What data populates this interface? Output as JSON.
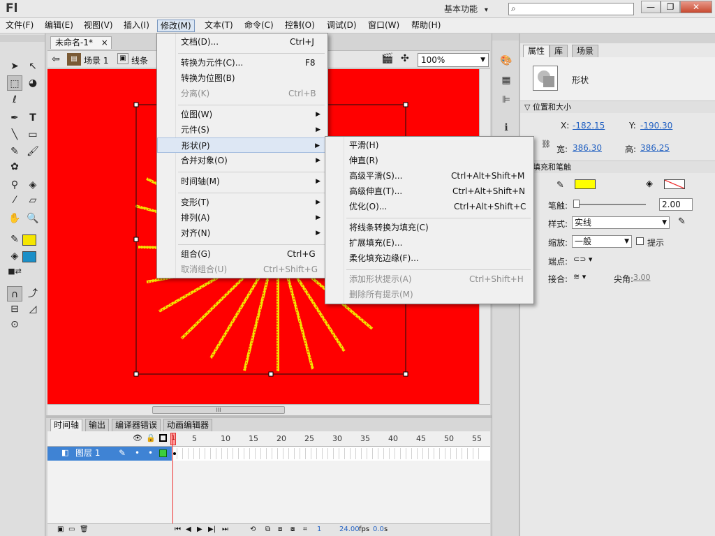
{
  "titlebar": {
    "logo": "Fl",
    "workspace": "基本功能",
    "workspace_arrow": "▾",
    "search_icon": "⌕",
    "buttons": [
      "—",
      "❐",
      "✕"
    ]
  },
  "menubar": {
    "items": [
      "文件(F)",
      "编辑(E)",
      "视图(V)",
      "插入(I)",
      "修改(M)",
      "文本(T)",
      "命令(C)",
      "控制(O)",
      "调试(D)",
      "窗口(W)",
      "帮助(H)"
    ]
  },
  "document": {
    "tab": "未命名-1*",
    "tab_close": "×",
    "back_arrow": "⇦",
    "scene": "场景 1",
    "breadcrumb_item": "线条",
    "zoom": "100%",
    "stage_color": "#ff0000",
    "scroll_grip": "III"
  },
  "stroke_color": "#f5e600",
  "modify_menu": {
    "items": [
      {
        "label": "文档(D)...",
        "shortcut": "Ctrl+J",
        "submenu": false,
        "disabled": false
      },
      {
        "label": "转换为元件(C)...",
        "shortcut": "F8",
        "submenu": false,
        "disabled": false
      },
      {
        "label": "转换为位图(B)",
        "shortcut": "",
        "submenu": false,
        "disabled": false
      },
      {
        "label": "分离(K)",
        "shortcut": "Ctrl+B",
        "submenu": false,
        "disabled": true
      },
      {
        "label": "位图(W)",
        "shortcut": "",
        "submenu": true,
        "disabled": false
      },
      {
        "label": "元件(S)",
        "shortcut": "",
        "submenu": true,
        "disabled": false
      },
      {
        "label": "形状(P)",
        "shortcut": "",
        "submenu": true,
        "disabled": false
      },
      {
        "label": "合并对象(O)",
        "shortcut": "",
        "submenu": true,
        "disabled": false
      },
      {
        "label": "时间轴(M)",
        "shortcut": "",
        "submenu": true,
        "disabled": false
      },
      {
        "label": "变形(T)",
        "shortcut": "",
        "submenu": true,
        "disabled": false
      },
      {
        "label": "排列(A)",
        "shortcut": "",
        "submenu": true,
        "disabled": false
      },
      {
        "label": "对齐(N)",
        "shortcut": "",
        "submenu": true,
        "disabled": false
      },
      {
        "label": "组合(G)",
        "shortcut": "Ctrl+G",
        "submenu": false,
        "disabled": false
      },
      {
        "label": "取消组合(U)",
        "shortcut": "Ctrl+Shift+G",
        "submenu": false,
        "disabled": true
      }
    ]
  },
  "shape_submenu": {
    "items": [
      {
        "label": "平滑(H)",
        "shortcut": "",
        "disabled": false
      },
      {
        "label": "伸直(R)",
        "shortcut": "",
        "disabled": false
      },
      {
        "label": "高级平滑(S)...",
        "shortcut": "Ctrl+Alt+Shift+M",
        "disabled": false
      },
      {
        "label": "高级伸直(T)...",
        "shortcut": "Ctrl+Alt+Shift+N",
        "disabled": false
      },
      {
        "label": "优化(O)...",
        "shortcut": "Ctrl+Alt+Shift+C",
        "disabled": false
      },
      {
        "label": "将线条转换为填充(C)",
        "shortcut": "",
        "disabled": false
      },
      {
        "label": "扩展填充(E)...",
        "shortcut": "",
        "disabled": false
      },
      {
        "label": "柔化填充边缘(F)...",
        "shortcut": "",
        "disabled": false
      },
      {
        "label": "添加形状提示(A)",
        "shortcut": "Ctrl+Shift+H",
        "disabled": true
      },
      {
        "label": "删除所有提示(M)",
        "shortcut": "",
        "disabled": true
      }
    ]
  },
  "timeline": {
    "tabs": [
      "时间轴",
      "输出",
      "编译器错误",
      "动画编辑器"
    ],
    "frame_numbers": [
      "1",
      "5",
      "10",
      "15",
      "20",
      "25",
      "30",
      "35",
      "40",
      "45",
      "50",
      "55"
    ],
    "layer_name": "图层 1",
    "current_frame": "1",
    "fps": "24.00",
    "fps_unit": "fps",
    "time": "0.0",
    "time_unit": "s",
    "playback_controls": [
      "⏮",
      "◀",
      "▶",
      "▶|",
      "⏭"
    ]
  },
  "properties": {
    "tabs": [
      "属性",
      "库",
      "场景"
    ],
    "object_type": "形状",
    "section_position": "位置和大小",
    "x_label": "X:",
    "x_value": "-182.15",
    "y_label": "Y:",
    "y_value": "-190.30",
    "width_label": "宽:",
    "width_value": "386.30",
    "height_label": "高:",
    "height_value": "386.25",
    "section_fill": "填充和笔触",
    "stroke_label": "笔触:",
    "stroke_value": "2.00",
    "style_label": "样式:",
    "style_value": "实线",
    "scale_label": "缩放:",
    "scale_value": "一般",
    "hint_label": "提示",
    "cap_label": "端点:",
    "join_label": "接合:",
    "miter_label": "尖角:",
    "miter_value": "3.00",
    "fill_color": "#ffff00"
  }
}
